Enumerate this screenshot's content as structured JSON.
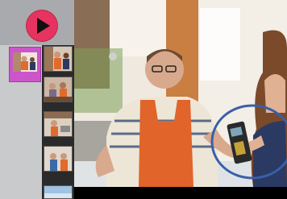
{
  "toolbar": {
    "play_icon": "play-icon",
    "play_color": "#e7335f"
  },
  "slides": {
    "count": 6,
    "selected_index": 0,
    "selected_color": "#cc55cc"
  },
  "photo": {
    "subject": "cafe-payment-photo",
    "annotation_icon": "ellipse-highlight",
    "annotation_color": "#3a5fa8"
  }
}
